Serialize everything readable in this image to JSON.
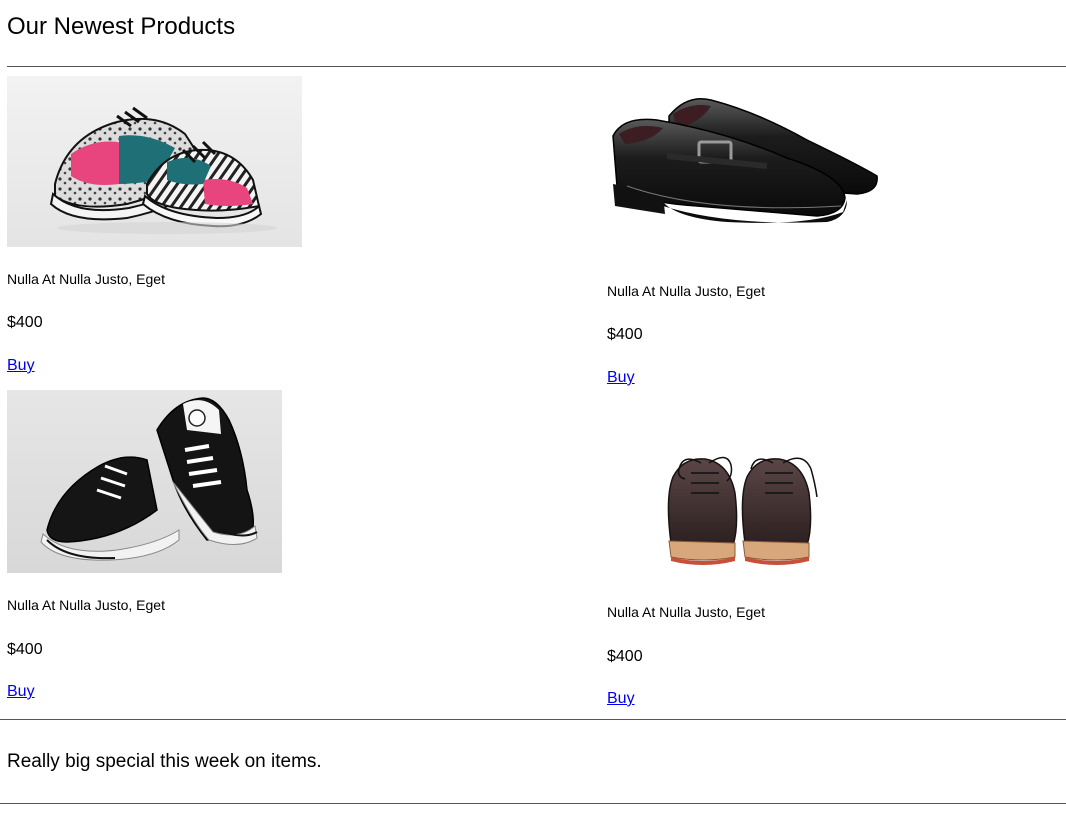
{
  "header": {
    "title": "Our Newest Products"
  },
  "products": [
    {
      "name": "Nulla At Nulla Justo, Eget",
      "price": "$400",
      "buy_label": "Buy",
      "image_icon": "pink-patterned-sneakers-image"
    },
    {
      "name": "Nulla At Nulla Justo, Eget",
      "price": "$400",
      "buy_label": "Buy",
      "image_icon": "black-leather-dress-shoes-image"
    },
    {
      "name": "Nulla At Nulla Justo, Eget",
      "price": "$400",
      "buy_label": "Buy",
      "image_icon": "black-canvas-sneakers-image"
    },
    {
      "name": "Nulla At Nulla Justo, Eget",
      "price": "$400",
      "buy_label": "Buy",
      "image_icon": "brown-leather-derby-shoes-image"
    }
  ],
  "footer": {
    "special_text": "Really big special this week on items."
  },
  "colors": {
    "link": "#0000ee",
    "rule": "#555555",
    "text": "#000000",
    "background": "#ffffff"
  }
}
